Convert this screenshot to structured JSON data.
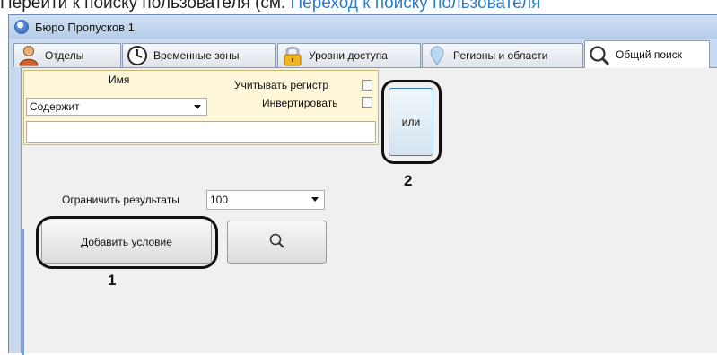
{
  "doc": {
    "line_text": "Перейти к поиску пользователя (см. ",
    "link_text": "Переход к поиску пользователя"
  },
  "window": {
    "title": "Бюро Пропусков 1",
    "title_icon": "app-globe-icon"
  },
  "tabs": [
    {
      "label": "Отделы",
      "icon": "person-icon"
    },
    {
      "label": "Временные зоны",
      "icon": "clock-icon"
    },
    {
      "label": "Уровни доступа",
      "icon": "lock-icon"
    },
    {
      "label": "Регионы и области",
      "icon": "region-pin-icon"
    },
    {
      "label": "Общий поиск",
      "icon": "search-icon",
      "active": true
    }
  ],
  "condition": {
    "field_label": "Имя",
    "match_mode": "Содержит",
    "case_sensitive_label": "Учитывать регистр",
    "case_sensitive_checked": false,
    "invert_label": "Инвертировать",
    "invert_checked": false,
    "value": "",
    "or_button_label": "или"
  },
  "limit": {
    "label": "Ограничить результаты",
    "value": "100"
  },
  "actions": {
    "add_condition_label": "Добавить условие",
    "search_icon": "search-icon"
  },
  "callouts": {
    "one": "1",
    "two": "2"
  },
  "colors": {
    "link": "#2f7dc8",
    "condition_bg": "#fdf6d8",
    "window_frame": "#c9daf0"
  }
}
